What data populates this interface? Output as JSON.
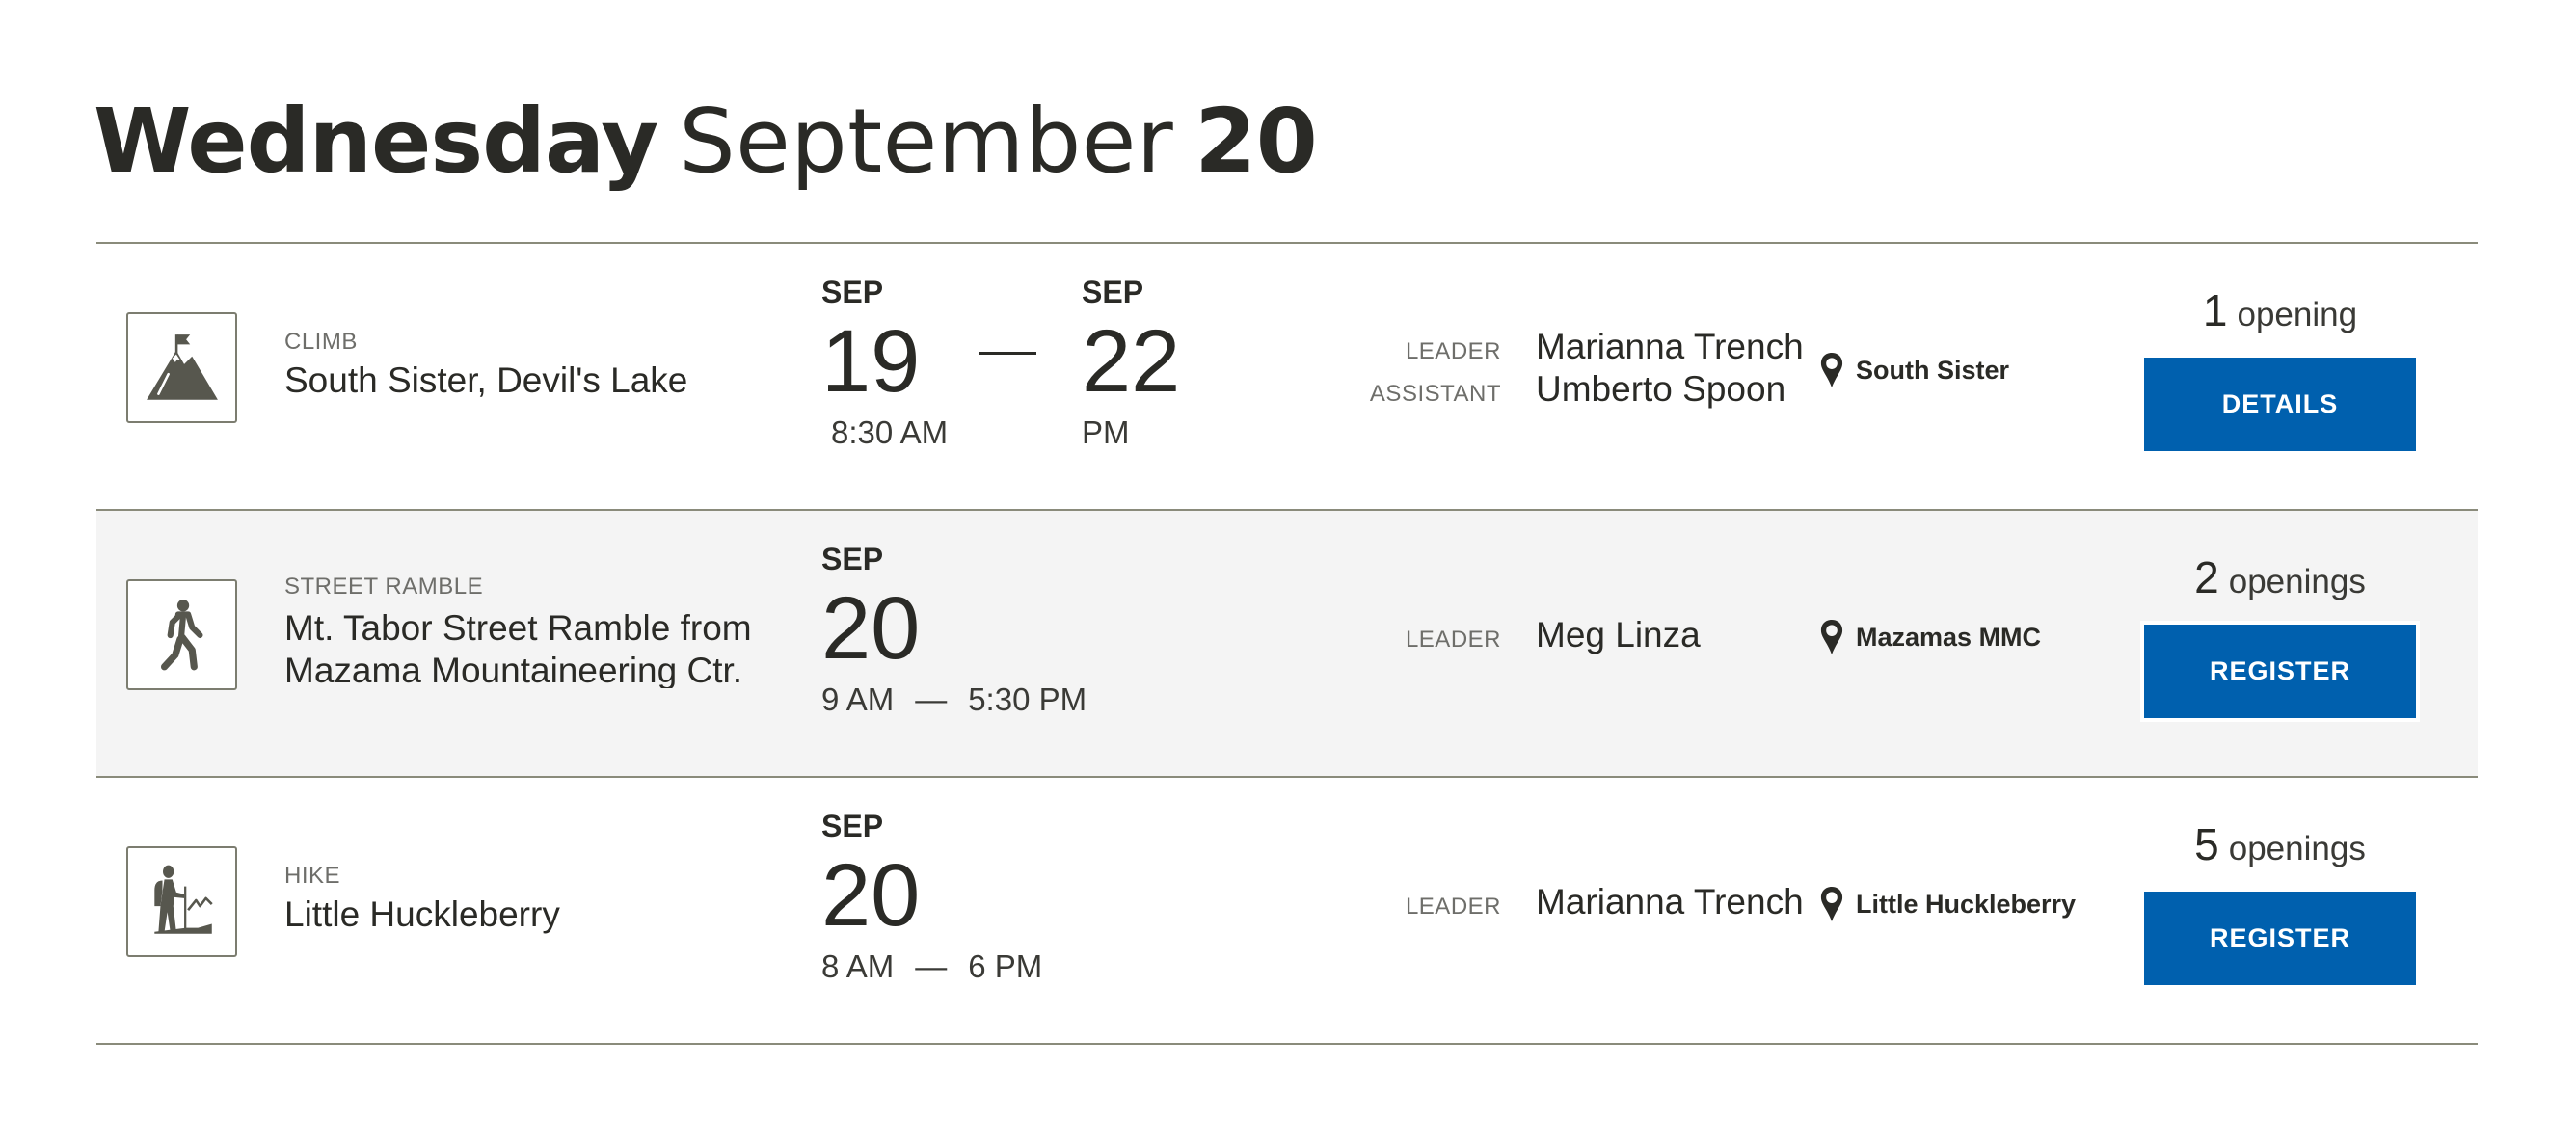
{
  "header": {
    "weekday": "Wednesday",
    "month": "September",
    "day": "20"
  },
  "events": [
    {
      "icon": "mountain-flag-icon",
      "category": "CLIMB",
      "title": "South Sister, Devil's Lake",
      "start": {
        "month": "SEP",
        "day": "19",
        "time": "8:30 AM"
      },
      "end": {
        "month": "SEP",
        "day": "22",
        "time": "PM"
      },
      "range_dash": "—",
      "roles": [
        {
          "label": "LEADER",
          "name": "Marianna Trench"
        },
        {
          "label": "ASSISTANT",
          "name": "Umberto Spoon"
        }
      ],
      "location": "South Sister",
      "openings": {
        "count": "1",
        "label": "opening"
      },
      "button": "DETAILS"
    },
    {
      "icon": "walking-person-icon",
      "category": "STREET RAMBLE",
      "title": "Mt. Tabor Street Ramble from Mazama Mountaineering Ctr.",
      "start": {
        "month": "SEP",
        "day": "20",
        "time": "9 AM",
        "time_sep": "—",
        "time_end": "5:30 PM"
      },
      "roles": [
        {
          "label": "LEADER",
          "name": "Meg Linza"
        }
      ],
      "location": "Mazamas MMC",
      "openings": {
        "count": "2",
        "label": "openings"
      },
      "button": "REGISTER"
    },
    {
      "icon": "hiker-icon",
      "category": "HIKE",
      "title": "Little Huckleberry",
      "start": {
        "month": "SEP",
        "day": "20",
        "time": "8 AM",
        "time_sep": "—",
        "time_end": "6 PM"
      },
      "roles": [
        {
          "label": "LEADER",
          "name": "Marianna Trench"
        }
      ],
      "location": "Little Huckleberry",
      "openings": {
        "count": "5",
        "label": "openings"
      },
      "button": "REGISTER"
    }
  ],
  "colors": {
    "button": "#0060ae",
    "divider": "#8a8b7b",
    "alt_row": "#f4f4f4",
    "icon": "#57574e",
    "text": "#2a2a26"
  }
}
